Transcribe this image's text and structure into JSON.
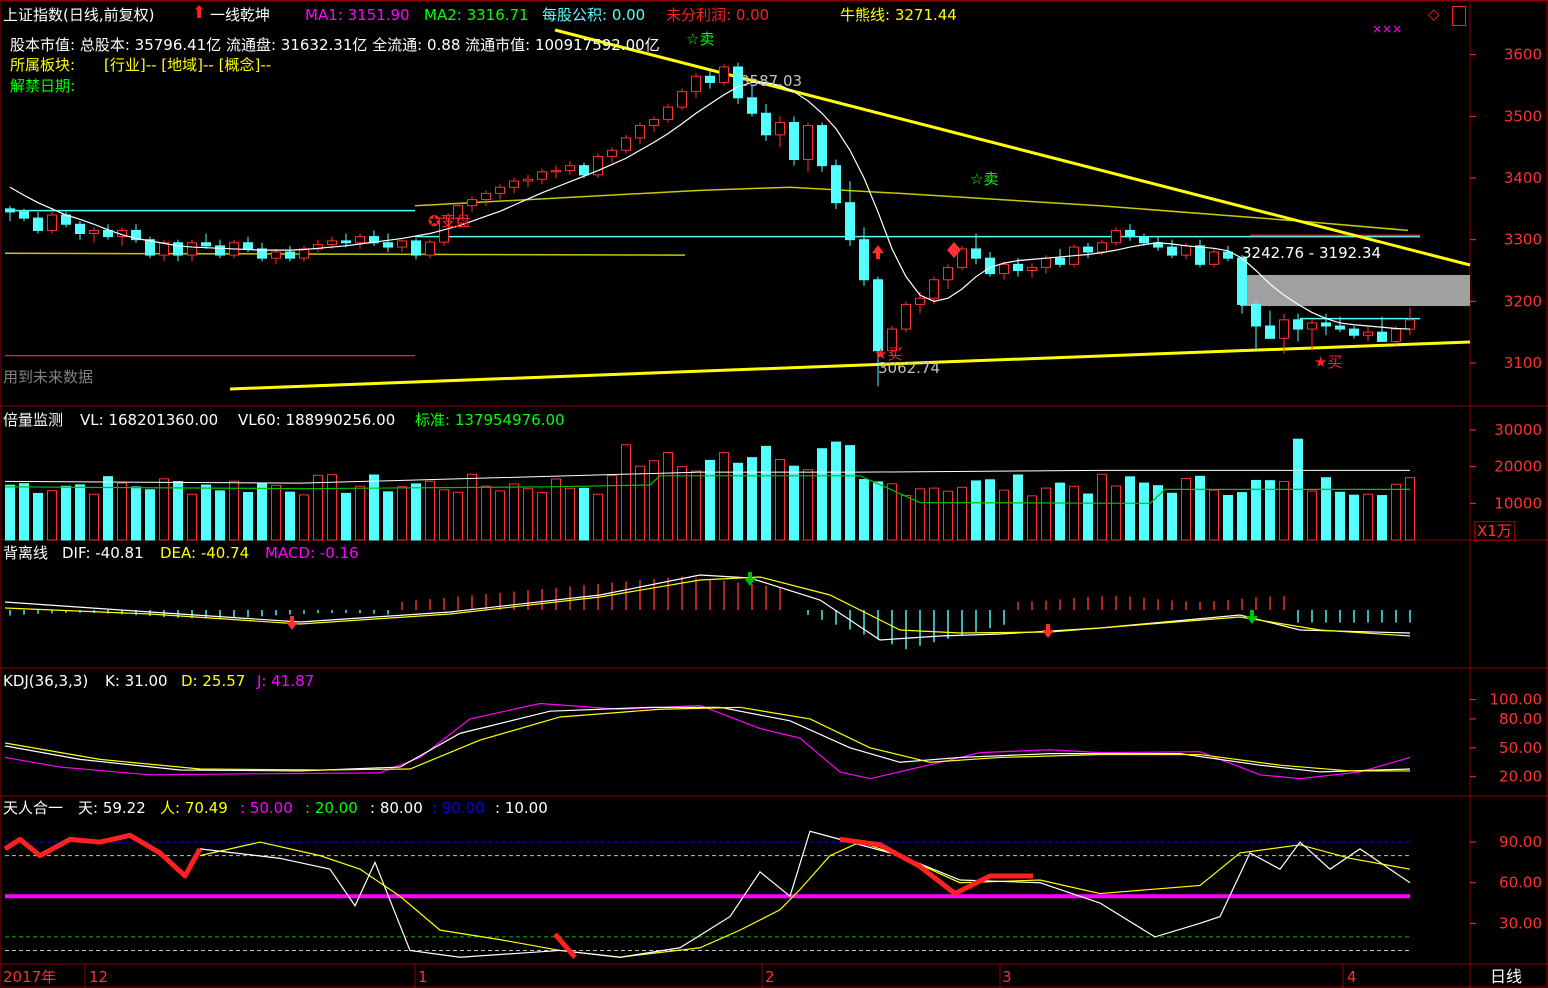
{
  "header": {
    "title": "上证指数(日线,前复权)",
    "indicator": "一线乾坤",
    "ma1": "MA1: 3151.90",
    "ma2": "MA2: 3316.71",
    "reserve": "每股公积: 0.00",
    "profit": "未分利润: 0.00",
    "bull_bear": "牛熊线: 3271.44",
    "top_right_marks": "×××",
    "top_right_icon": "diamond-icon"
  },
  "info": {
    "line1": "股本市值: 总股本: 35796.41亿 流通盘: 31632.31亿 全流通: 0.88 流通市值: 100917592.00亿",
    "line2_label": "所属板块:",
    "line2_value": "[行业]-- [地域]-- [概念]--",
    "line3": "解禁日期:",
    "future": "用到未来数据"
  },
  "annotations": {
    "high": "3587.03",
    "low": "3062.74",
    "range": "3242.76 - 3192.34",
    "sell": "☆卖",
    "buy": "★买",
    "bian": "变盘"
  },
  "volume_panel": {
    "label": "倍量监测",
    "vl": "VL: 168201360.00",
    "vl60": "VL60: 188990256.00",
    "std": "标准: 137954976.00",
    "unit": "X1万"
  },
  "macd_panel": {
    "label": "背离线",
    "dif": "DIF: -40.81",
    "dea": "DEA: -40.74",
    "macd": "MACD: -0.16"
  },
  "kdj_panel": {
    "label": "KDJ(36,3,3)",
    "k": "K: 31.00",
    "d": "D: 25.57",
    "j": "J: 41.87"
  },
  "tianren_panel": {
    "label": "天人合一",
    "tian": "天: 59.22",
    "ren": "人: 70.49",
    "l50": ": 50.00",
    "l20": ": 20.00",
    "l80": ": 80.00",
    "l90": ": 90.00",
    "l10": ": 10.00"
  },
  "footer": {
    "period": "日线",
    "dates": [
      "2017年",
      "12",
      "1",
      "2",
      "3",
      "4"
    ]
  },
  "colors": {
    "up": "#ff3030",
    "down": "#54ffff",
    "ma": "#ffffff",
    "yellow": "#ffff00",
    "magenta": "#ff00ff",
    "green": "#00c000",
    "bg": "#000000"
  },
  "chart_data": [
    {
      "type": "candlestick",
      "title": "上证指数(日线,前复权)",
      "y_ticks": [
        3600,
        3500,
        3400,
        3300,
        3200,
        3100
      ],
      "ylim": [
        3040,
        3640
      ],
      "candles": [
        [
          3350,
          3355,
          3330,
          3345
        ],
        [
          3345,
          3350,
          3330,
          3335
        ],
        [
          3335,
          3345,
          3310,
          3315
        ],
        [
          3315,
          3345,
          3310,
          3340
        ],
        [
          3340,
          3345,
          3320,
          3325
        ],
        [
          3325,
          3330,
          3300,
          3310
        ],
        [
          3310,
          3320,
          3295,
          3315
        ],
        [
          3315,
          3325,
          3300,
          3305
        ],
        [
          3305,
          3320,
          3290,
          3315
        ],
        [
          3315,
          3325,
          3295,
          3300
        ],
        [
          3300,
          3305,
          3270,
          3275
        ],
        [
          3275,
          3300,
          3265,
          3295
        ],
        [
          3295,
          3300,
          3265,
          3275
        ],
        [
          3275,
          3300,
          3265,
          3295
        ],
        [
          3295,
          3310,
          3285,
          3290
        ],
        [
          3290,
          3300,
          3270,
          3275
        ],
        [
          3275,
          3300,
          3270,
          3295
        ],
        [
          3295,
          3305,
          3280,
          3285
        ],
        [
          3285,
          3295,
          3265,
          3270
        ],
        [
          3270,
          3285,
          3260,
          3280
        ],
        [
          3280,
          3290,
          3265,
          3270
        ],
        [
          3270,
          3290,
          3265,
          3285
        ],
        [
          3285,
          3300,
          3280,
          3292
        ],
        [
          3292,
          3305,
          3285,
          3298
        ],
        [
          3298,
          3310,
          3288,
          3295
        ],
        [
          3295,
          3310,
          3285,
          3305
        ],
        [
          3305,
          3315,
          3290,
          3295
        ],
        [
          3295,
          3310,
          3280,
          3288
        ],
        [
          3288,
          3300,
          3280,
          3298
        ],
        [
          3298,
          3302,
          3268,
          3275
        ],
        [
          3275,
          3300,
          3270,
          3296
        ],
        [
          3296,
          3340,
          3290,
          3335
        ],
        [
          3335,
          3360,
          3325,
          3355
        ],
        [
          3355,
          3370,
          3345,
          3365
        ],
        [
          3365,
          3380,
          3355,
          3375
        ],
        [
          3375,
          3390,
          3365,
          3385
        ],
        [
          3385,
          3400,
          3375,
          3395
        ],
        [
          3395,
          3405,
          3385,
          3398
        ],
        [
          3398,
          3415,
          3390,
          3410
        ],
        [
          3410,
          3420,
          3400,
          3412
        ],
        [
          3412,
          3428,
          3405,
          3420
        ],
        [
          3420,
          3425,
          3400,
          3405
        ],
        [
          3405,
          3440,
          3400,
          3435
        ],
        [
          3435,
          3450,
          3425,
          3445
        ],
        [
          3445,
          3470,
          3440,
          3465
        ],
        [
          3465,
          3490,
          3455,
          3485
        ],
        [
          3485,
          3500,
          3475,
          3495
        ],
        [
          3495,
          3520,
          3490,
          3515
        ],
        [
          3515,
          3545,
          3510,
          3540
        ],
        [
          3540,
          3570,
          3530,
          3565
        ],
        [
          3565,
          3575,
          3545,
          3555
        ],
        [
          3555,
          3585,
          3550,
          3580
        ],
        [
          3580,
          3587,
          3520,
          3530
        ],
        [
          3530,
          3550,
          3500,
          3505
        ],
        [
          3505,
          3520,
          3460,
          3470
        ],
        [
          3470,
          3500,
          3450,
          3490
        ],
        [
          3490,
          3500,
          3420,
          3430
        ],
        [
          3430,
          3490,
          3410,
          3485
        ],
        [
          3485,
          3490,
          3410,
          3420
        ],
        [
          3420,
          3430,
          3350,
          3360
        ],
        [
          3360,
          3395,
          3290,
          3300
        ],
        [
          3300,
          3320,
          3225,
          3235
        ],
        [
          3235,
          3240,
          3062,
          3120
        ],
        [
          3120,
          3160,
          3110,
          3155
        ],
        [
          3155,
          3200,
          3150,
          3195
        ],
        [
          3195,
          3215,
          3180,
          3205
        ],
        [
          3205,
          3240,
          3195,
          3235
        ],
        [
          3235,
          3260,
          3220,
          3255
        ],
        [
          3255,
          3290,
          3250,
          3285
        ],
        [
          3285,
          3310,
          3260,
          3270
        ],
        [
          3270,
          3280,
          3240,
          3245
        ],
        [
          3245,
          3265,
          3235,
          3260
        ],
        [
          3260,
          3270,
          3240,
          3250
        ],
        [
          3250,
          3262,
          3238,
          3255
        ],
        [
          3255,
          3275,
          3245,
          3270
        ],
        [
          3270,
          3285,
          3255,
          3260
        ],
        [
          3260,
          3292,
          3255,
          3288
        ],
        [
          3288,
          3295,
          3270,
          3280
        ],
        [
          3280,
          3300,
          3275,
          3295
        ],
        [
          3295,
          3320,
          3290,
          3315
        ],
        [
          3315,
          3325,
          3298,
          3305
        ],
        [
          3305,
          3310,
          3290,
          3295
        ],
        [
          3295,
          3305,
          3282,
          3288
        ],
        [
          3288,
          3300,
          3270,
          3275
        ],
        [
          3275,
          3295,
          3268,
          3290
        ],
        [
          3290,
          3300,
          3255,
          3260
        ],
        [
          3260,
          3285,
          3255,
          3280
        ],
        [
          3280,
          3290,
          3265,
          3270
        ],
        [
          3270,
          3275,
          3180,
          3195
        ],
        [
          3195,
          3200,
          3120,
          3160
        ],
        [
          3160,
          3185,
          3140,
          3140
        ],
        [
          3140,
          3180,
          3115,
          3170
        ],
        [
          3170,
          3180,
          3135,
          3155
        ],
        [
          3155,
          3170,
          3120,
          3165
        ],
        [
          3165,
          3180,
          3145,
          3160
        ],
        [
          3160,
          3175,
          3150,
          3155
        ],
        [
          3155,
          3160,
          3140,
          3145
        ],
        [
          3145,
          3160,
          3135,
          3150
        ],
        [
          3150,
          3175,
          3140,
          3135
        ],
        [
          3135,
          3160,
          3130,
          3155
        ],
        [
          3155,
          3190,
          3145,
          3170
        ]
      ],
      "ma1": [
        3385,
        3372,
        3360,
        3350,
        3340,
        3333,
        3325,
        3316,
        3308,
        3302,
        3298,
        3294,
        3290,
        3288,
        3287,
        3286,
        3285,
        3284,
        3283,
        3283,
        3283,
        3284,
        3286,
        3288,
        3290,
        3293,
        3296,
        3299,
        3302,
        3306,
        3310,
        3316,
        3322,
        3330,
        3338,
        3346,
        3356,
        3366,
        3376,
        3385,
        3394,
        3403,
        3412,
        3422,
        3432,
        3445,
        3458,
        3472,
        3488,
        3505,
        3520,
        3535,
        3548,
        3555,
        3555,
        3550,
        3540,
        3525,
        3505,
        3480,
        3445,
        3400,
        3345,
        3285,
        3240,
        3210,
        3200,
        3205,
        3220,
        3240,
        3255,
        3262,
        3266,
        3268,
        3270,
        3272,
        3274,
        3276,
        3279,
        3283,
        3288,
        3292,
        3295,
        3293,
        3290,
        3288,
        3286,
        3282,
        3270,
        3250,
        3228,
        3210,
        3195,
        3182,
        3172,
        3165,
        3162,
        3160,
        3158,
        3156,
        3155
      ],
      "ma2_level": 3390,
      "annotation_high": 3587.03,
      "annotation_low": 3062.74,
      "range_box": [
        3192.34,
        3242.76
      ]
    },
    {
      "type": "bar",
      "title": "倍量监测",
      "y_ticks": [
        30000,
        20000,
        10000
      ],
      "unit": "X1万",
      "ylim": [
        0,
        30000
      ]
    },
    {
      "type": "bar",
      "title": "背离线 MACD",
      "series": [
        {
          "name": "DIF"
        },
        {
          "name": "DEA"
        },
        {
          "name": "MACD"
        }
      ]
    },
    {
      "type": "line",
      "title": "KDJ(36,3,3)",
      "y_ticks": [
        100,
        80,
        50,
        20
      ],
      "ylim": [
        0,
        110
      ]
    },
    {
      "type": "line",
      "title": "天人合一",
      "y_ticks": [
        90,
        60,
        30
      ],
      "ylim": [
        0,
        110
      ],
      "levels": [
        90,
        80,
        50,
        20,
        10
      ]
    }
  ]
}
